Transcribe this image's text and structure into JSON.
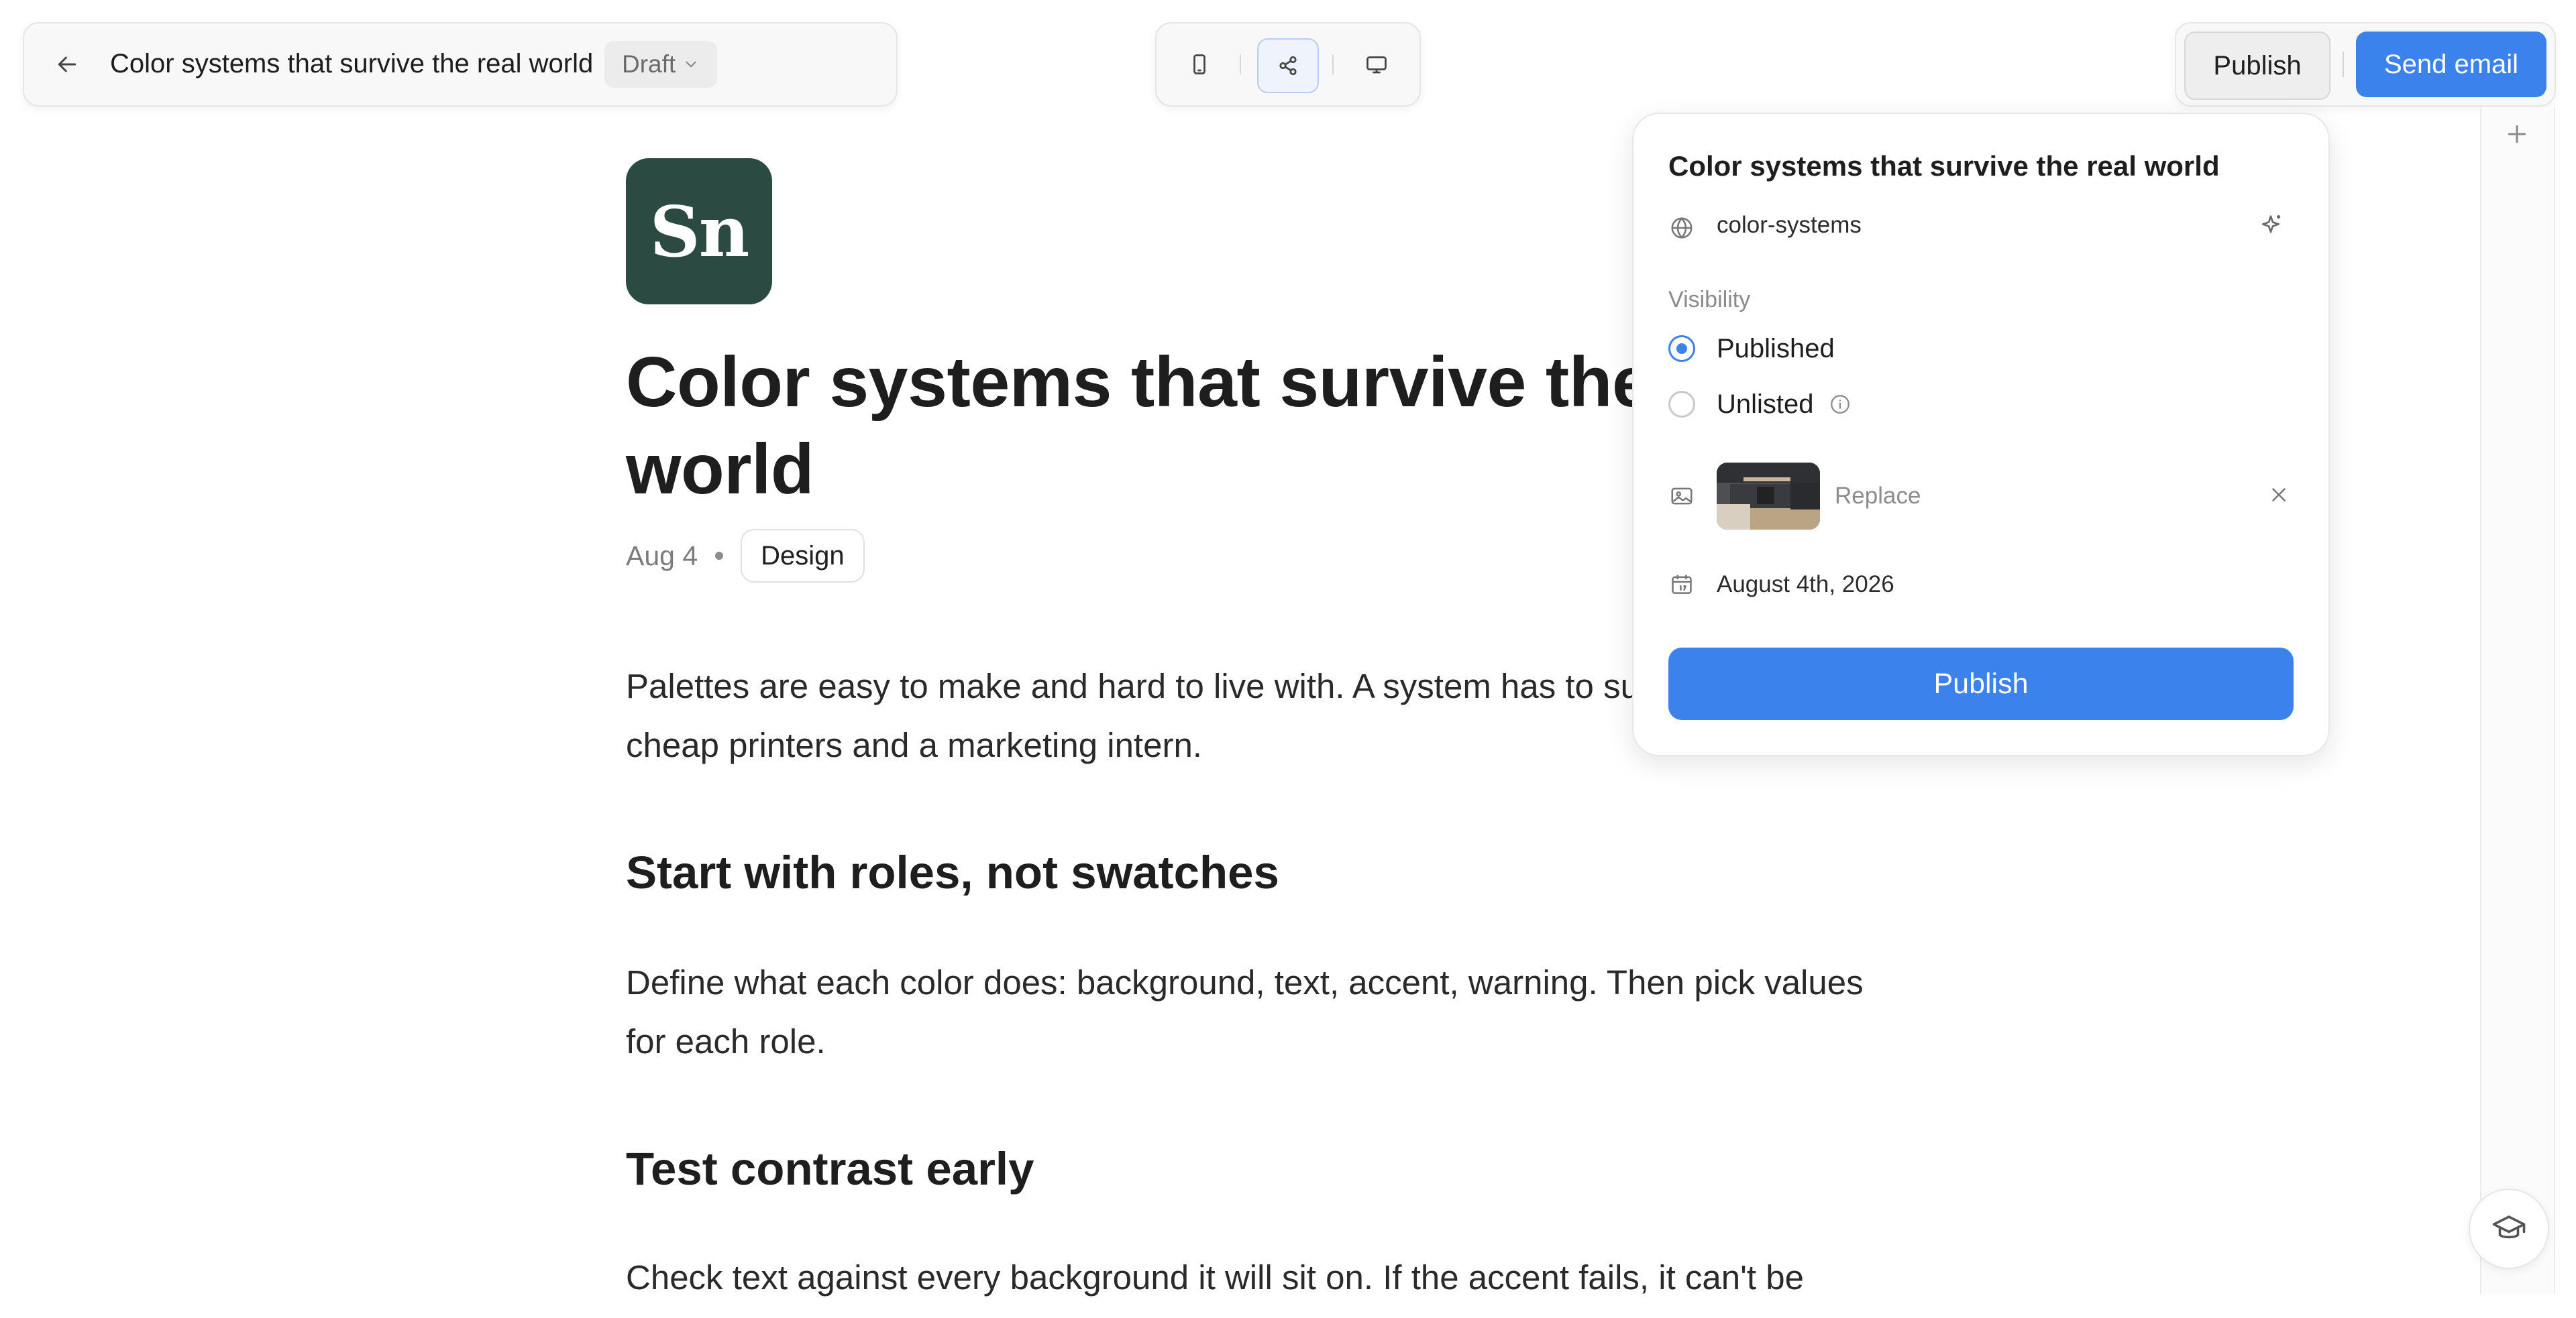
{
  "topbar": {
    "doc_title": "Color systems that survive the real world",
    "status": "Draft",
    "publish_label": "Publish",
    "send_email_label": "Send email"
  },
  "icons": [
    "arrow-left-icon",
    "chevron-down-icon",
    "mobile-icon",
    "share-icon",
    "desktop-icon",
    "plus-icon",
    "graduation-cap-icon",
    "globe-icon",
    "sparkle-icon",
    "info-icon",
    "image-icon",
    "close-icon",
    "calendar-icon"
  ],
  "article": {
    "logo_text": "Sn",
    "title": "Color systems that survive the real world",
    "date": "Aug 4",
    "tag": "Design",
    "intro": "Palettes are easy to make and hard to live with. A system has to survive dark mode, cheap printers and a marketing intern.",
    "section1_heading": "Start with roles, not swatches",
    "section1_body": "Define what each color does: background, text, accent, warning. Then pick values for each role.",
    "section2_heading": "Test contrast early",
    "section2_body": "Check text against every background it will sit on. If the accent fails, it can't be"
  },
  "popover": {
    "title": "Color systems that survive the real world",
    "slug": "color-systems",
    "visibility_label": "Visibility",
    "options": [
      {
        "label": "Published",
        "selected": true
      },
      {
        "label": "Unlisted",
        "selected": false
      }
    ],
    "replace_label": "Replace",
    "publish_date": "August 4th, 2026",
    "publish_button": "Publish"
  },
  "colors": {
    "accent": "#3b82ec",
    "logo_bg": "#2b4a42"
  }
}
